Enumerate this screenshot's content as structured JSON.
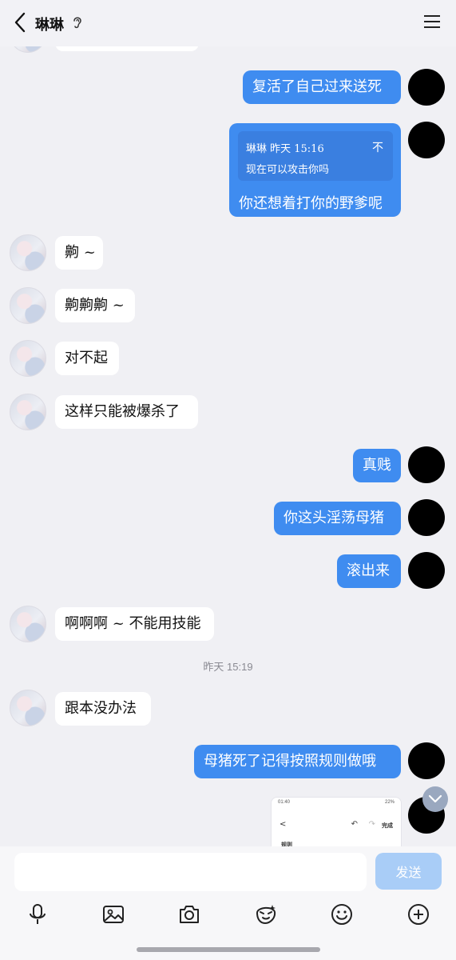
{
  "header": {
    "title": "琳琳"
  },
  "messages": {
    "m1": "复活了自己过来送死",
    "quote_author_time": "琳琳 昨天 15:16",
    "quote_close": "不",
    "quote_text": "现在可以攻击你吗",
    "m2": "你还想着打你的野爹呢",
    "m3": "齁 ~",
    "m4": "齁齁齁 ~",
    "m5": "对不起",
    "m6": "这样只能被爆杀了",
    "m7": "真贱",
    "m8": "你这头淫荡母猪",
    "m9": "滚出来",
    "m10": "啊啊啊 ~ 不能用技能",
    "time_separator": "昨天 15:19",
    "m11": "跟本没办法",
    "m12": "母猪死了记得按照规则做哦"
  },
  "screenshot_preview": {
    "status_time": "01:40",
    "status_right": "22%",
    "back": "<",
    "undo": "↶",
    "redo": "↷",
    "done": "完成",
    "title": "规则"
  },
  "input": {
    "placeholder": "",
    "send_label": "发送"
  },
  "toolbar": [
    "microphone-icon",
    "image-icon",
    "camera-icon",
    "sticker-icon",
    "emoji-icon",
    "plus-icon"
  ],
  "colors": {
    "outgoing_bubble": "#3f8cf0",
    "incoming_bubble": "#ffffff",
    "background": "#f0f0f4",
    "send_button": "#a9cdf7"
  }
}
